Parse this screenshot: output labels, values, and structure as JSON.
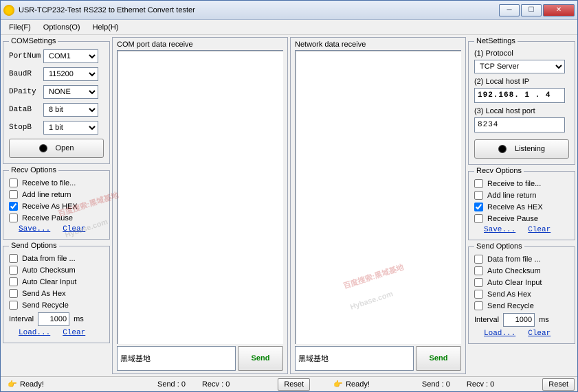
{
  "window": {
    "title": "USR-TCP232-Test  RS232 to Ethernet Convert tester"
  },
  "menu": {
    "file": "File(F)",
    "options": "Options(O)",
    "help": "Help(H)"
  },
  "com": {
    "legend": "COMSettings",
    "portnum_label": "PortNum",
    "portnum_value": "COM1",
    "baud_label": "BaudR",
    "baud_value": "115200",
    "parity_label": "DPaity",
    "parity_value": "NONE",
    "datab_label": "DataB",
    "datab_value": "8 bit",
    "stopb_label": "StopB",
    "stopb_value": "1 bit",
    "open_btn": "Open"
  },
  "net": {
    "legend": "NetSettings",
    "proto_label": "(1) Protocol",
    "proto_value": "TCP Server",
    "ip_label": "(2) Local host IP",
    "ip_value": "192.168. 1 . 4",
    "port_label": "(3) Local host port",
    "port_value": "8234",
    "listen_btn": "Listening"
  },
  "recv": {
    "legend": "Recv Options",
    "to_file": "Receive to file...",
    "add_line": "Add line return",
    "as_hex": "Receive As HEX",
    "pause": "Receive Pause",
    "save_link": "Save...",
    "clear_link": "Clear"
  },
  "send": {
    "legend": "Send Options",
    "from_file": "Data from file ...",
    "auto_cksum": "Auto Checksum",
    "auto_clear": "Auto Clear Input",
    "as_hex": "Send As Hex",
    "recycle": "Send Recycle",
    "interval_label": "Interval",
    "interval_value": "1000",
    "interval_unit": "ms",
    "load_link": "Load...",
    "clear_link": "Clear"
  },
  "mid": {
    "com_title": "COM port data receive",
    "net_title": "Network data receive",
    "input_text": "黑域基地",
    "send_btn": "Send"
  },
  "status": {
    "ready": "Ready!",
    "send_label": "Send : 0",
    "recv_label": "Recv : 0",
    "reset": "Reset"
  },
  "watermark": {
    "cn1": "百度搜索:黑域基地",
    "en1": "Hybase.com",
    "cn2": "百度搜索:黑域基地",
    "en2": "Hybase.com"
  }
}
